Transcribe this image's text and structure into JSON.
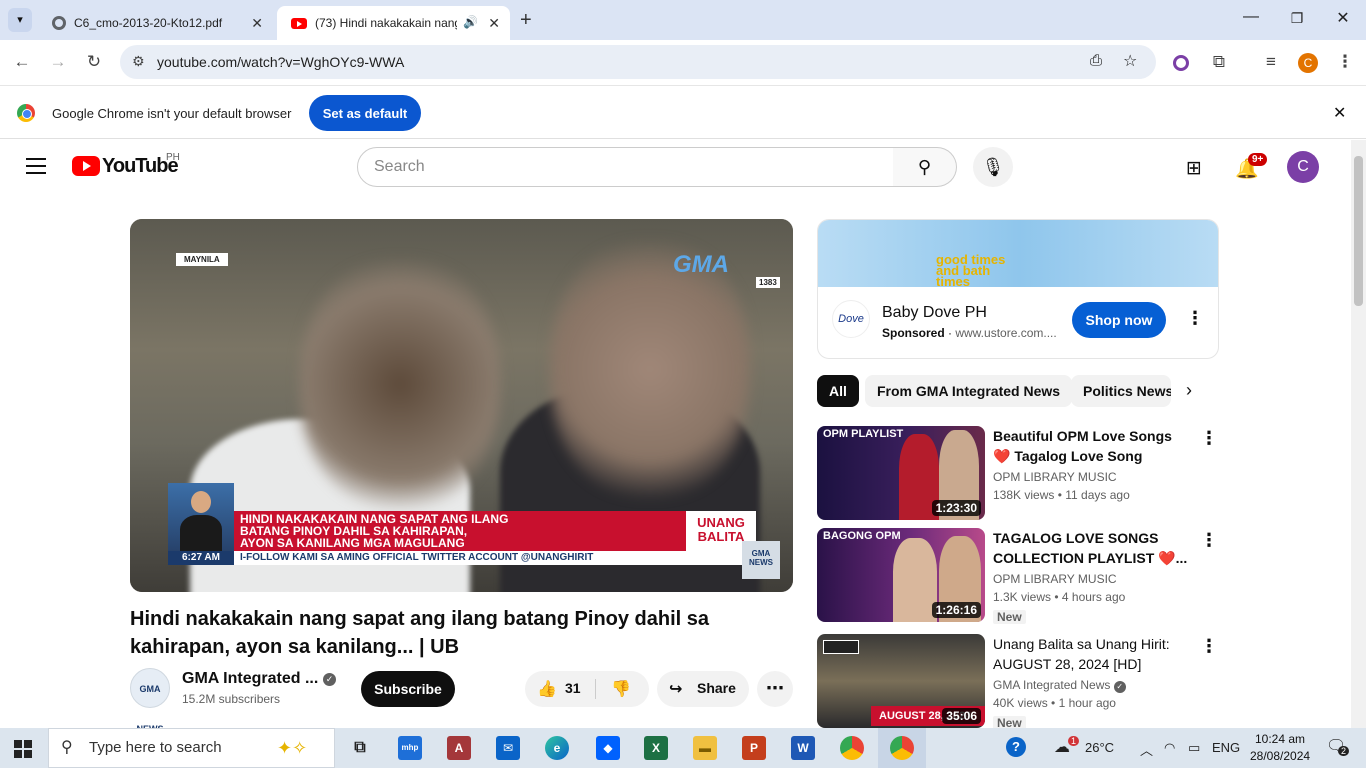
{
  "browser": {
    "tabs": [
      {
        "title": "C6_cmo-2013-20-Kto12.pdf",
        "active": false
      },
      {
        "title": "(73) Hindi nakakakain nang",
        "active": true
      }
    ],
    "url": "youtube.com/watch?v=WghOYc9-WWA",
    "profile_initial": "C",
    "infobar": {
      "message": "Google Chrome isn't your default browser",
      "button": "Set as default"
    }
  },
  "youtube": {
    "logo_text": "YouTube",
    "country": "PH",
    "search_placeholder": "Search",
    "notifications_badge": "9+",
    "avatar_initial": "C"
  },
  "video": {
    "overlay": {
      "location": "MAYNILA",
      "network": "GMA",
      "plate": "1383",
      "headline_line1": "HINDI NAKAKAKAIN NANG SAPAT ANG ILANG",
      "headline_line2": "BATANG PINOY DAHIL SA KAHIRAPAN,",
      "headline_line3": "AYON SA KANILANG MGA MAGULANG",
      "show": "UNANG BALITA",
      "time": "6:27 AM",
      "ticker": "I-FOLLOW KAMI SA AMING OFFICIAL TWITTER ACCOUNT @UNANGHIRIT",
      "corner_logo": "GMA NEWS"
    },
    "title": "Hindi nakakakain nang sapat ang ilang batang Pinoy dahil sa kahirapan, ayon sa kanilang... | UB",
    "channel": "GMA Integrated ...",
    "channel_logo": "GMA NEWS",
    "subscribers": "15.2M subscribers",
    "subscribe_label": "Subscribe",
    "likes": "31",
    "share_label": "Share"
  },
  "ad": {
    "banner_text": "good times and bath times",
    "advertiser": "Baby Dove PH",
    "logo": "Dove",
    "sponsored": "Sponsored",
    "domain": "www.ustore.com....",
    "cta": "Shop now"
  },
  "chips": [
    "All",
    "From GMA Integrated News",
    "Politics News"
  ],
  "suggested": [
    {
      "title": "Beautiful OPM Love Songs ❤️ Tagalog Love Song Collection...",
      "channel": "OPM LIBRARY MUSIC",
      "views": "138K views",
      "age": "11 days ago",
      "duration": "1:23:30",
      "label": "OPM PLAYLIST",
      "new": ""
    },
    {
      "title": "TAGALOG LOVE SONGS COLLECTION PLAYLIST ❤️...",
      "channel": "OPM LIBRARY MUSIC",
      "views": "1.3K views",
      "age": "4 hours ago",
      "duration": "1:26:16",
      "label": "BAGONG OPM",
      "new": "New"
    },
    {
      "title": "Unang Balita sa Unang Hirit: AUGUST 28, 2024 [HD]",
      "channel": "GMA Integrated News",
      "views": "40K views",
      "age": "1 hour ago",
      "duration": "35:06",
      "label": "AUGUST 28, 2024",
      "new": "New"
    }
  ],
  "taskbar": {
    "search_placeholder": "Type here to search",
    "temperature": "26°C",
    "language": "ENG",
    "time": "10:24 am",
    "date": "28/08/2024",
    "notification_count": "2",
    "weather_alert": "1"
  }
}
